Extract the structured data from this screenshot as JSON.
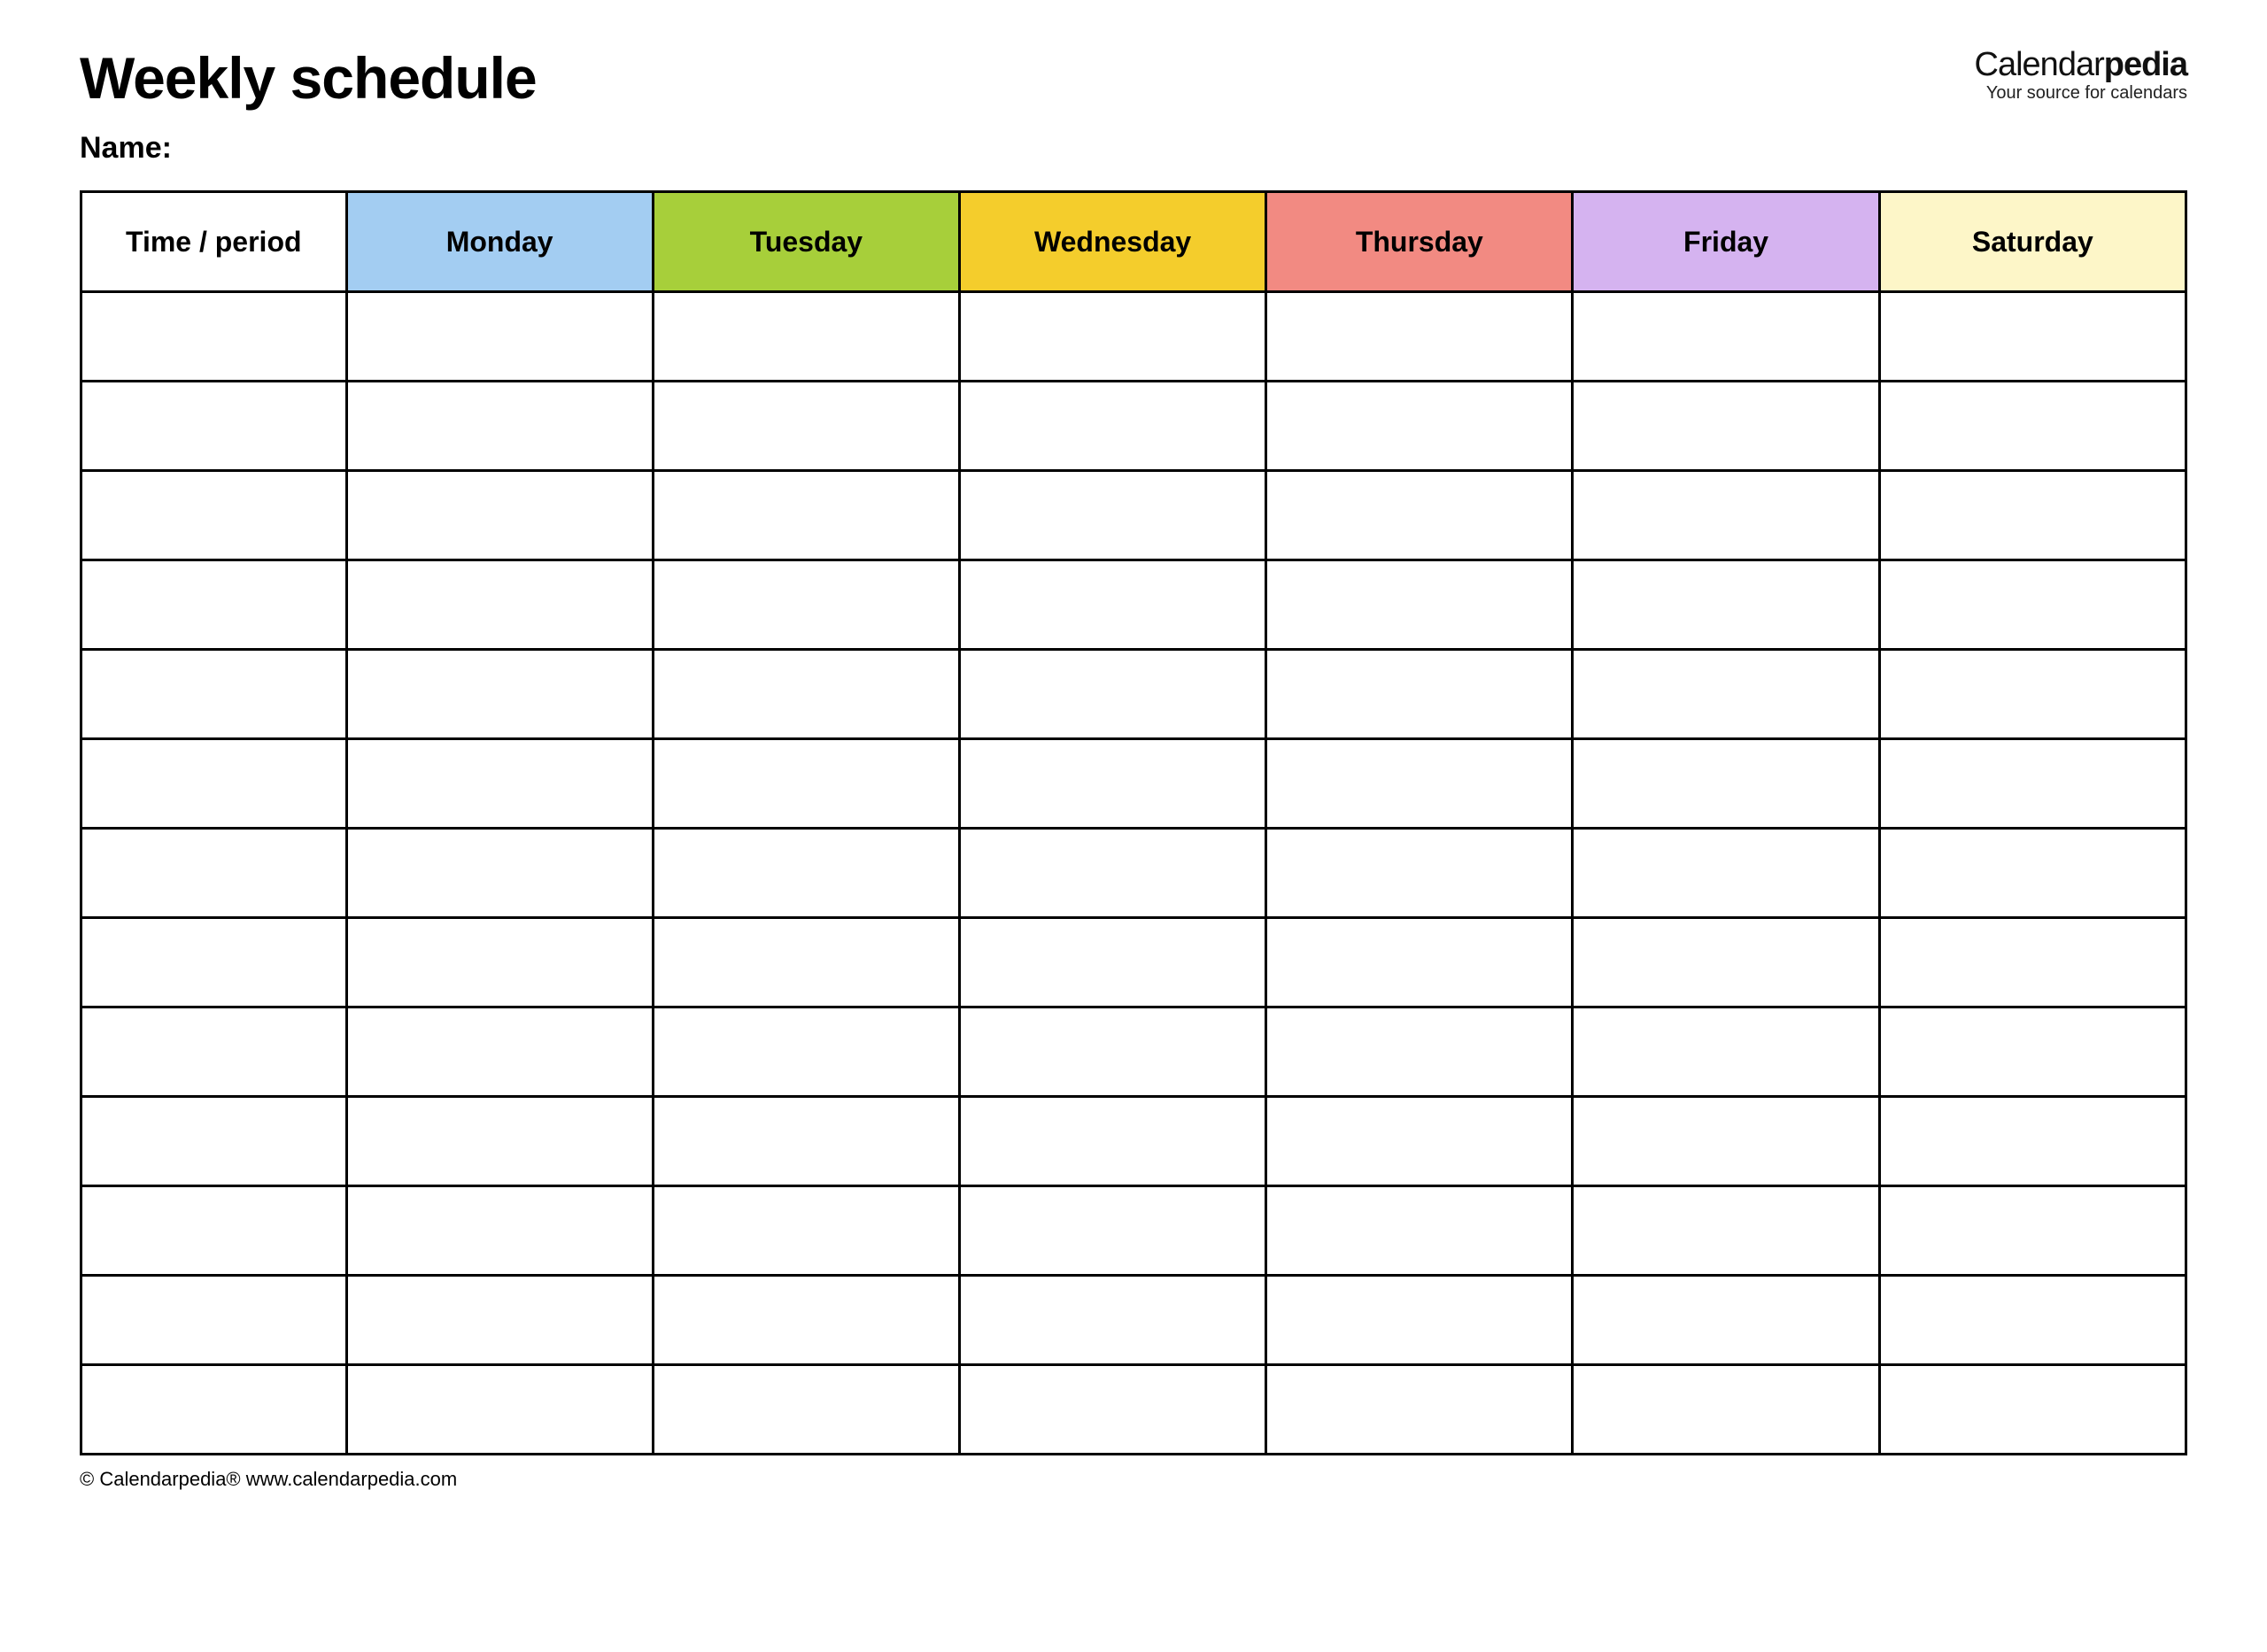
{
  "header": {
    "title": "Weekly schedule",
    "name_label": "Name:"
  },
  "brand": {
    "name_plain": "Calendar",
    "name_bold": "pedia",
    "tagline": "Your source for calendars"
  },
  "table": {
    "time_header": "Time / period",
    "days": [
      "Monday",
      "Tuesday",
      "Wednesday",
      "Thursday",
      "Friday",
      "Saturday"
    ],
    "day_colors": [
      "#a3cdf2",
      "#a7cf3a",
      "#f4cd2c",
      "#f28a82",
      "#d5b3f0",
      "#fdf6c8"
    ],
    "row_count": 13
  },
  "footer": {
    "copyright": "© Calendarpedia®   www.calendarpedia.com"
  }
}
